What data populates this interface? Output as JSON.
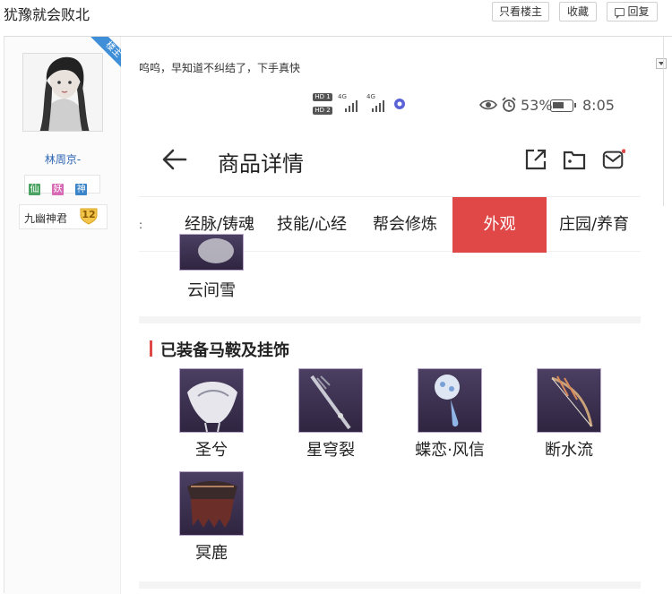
{
  "thread": {
    "title": "犹豫就会败北",
    "only_op_label": "只看楼主",
    "favorite_label": "收藏",
    "reply_label": "回复"
  },
  "author": {
    "op_tag": "楼主",
    "username": "林周京-",
    "badges": [
      "仙",
      "妖",
      "神"
    ],
    "rank_title": "九幽神君",
    "level": "12"
  },
  "post": {
    "text": "呜呜，早知道不纠结了，下手真快"
  },
  "phone": {
    "status": {
      "network_1": "HD 1",
      "network_2": "HD 2",
      "sig_1": "4G",
      "sig_2": "4G",
      "battery": "53%",
      "time": "8:05"
    },
    "header": {
      "title": "商品详情"
    },
    "tabs": [
      {
        "label": "经脉/铸魂",
        "active": false
      },
      {
        "label": "技能/心经",
        "active": false
      },
      {
        "label": "帮会修炼",
        "active": false
      },
      {
        "label": "外观",
        "active": true
      },
      {
        "label": "庄园/养育",
        "active": false
      }
    ],
    "tab_overflow_mark": ":",
    "accent_color": "#e04848",
    "partial_item": {
      "label": "云间雪"
    },
    "section": {
      "title": "已装备马鞍及挂饰",
      "items": [
        {
          "label": "圣兮"
        },
        {
          "label": "星穹裂"
        },
        {
          "label": "蝶恋·风信"
        },
        {
          "label": "断水流"
        },
        {
          "label": "冥鹿"
        }
      ]
    }
  }
}
